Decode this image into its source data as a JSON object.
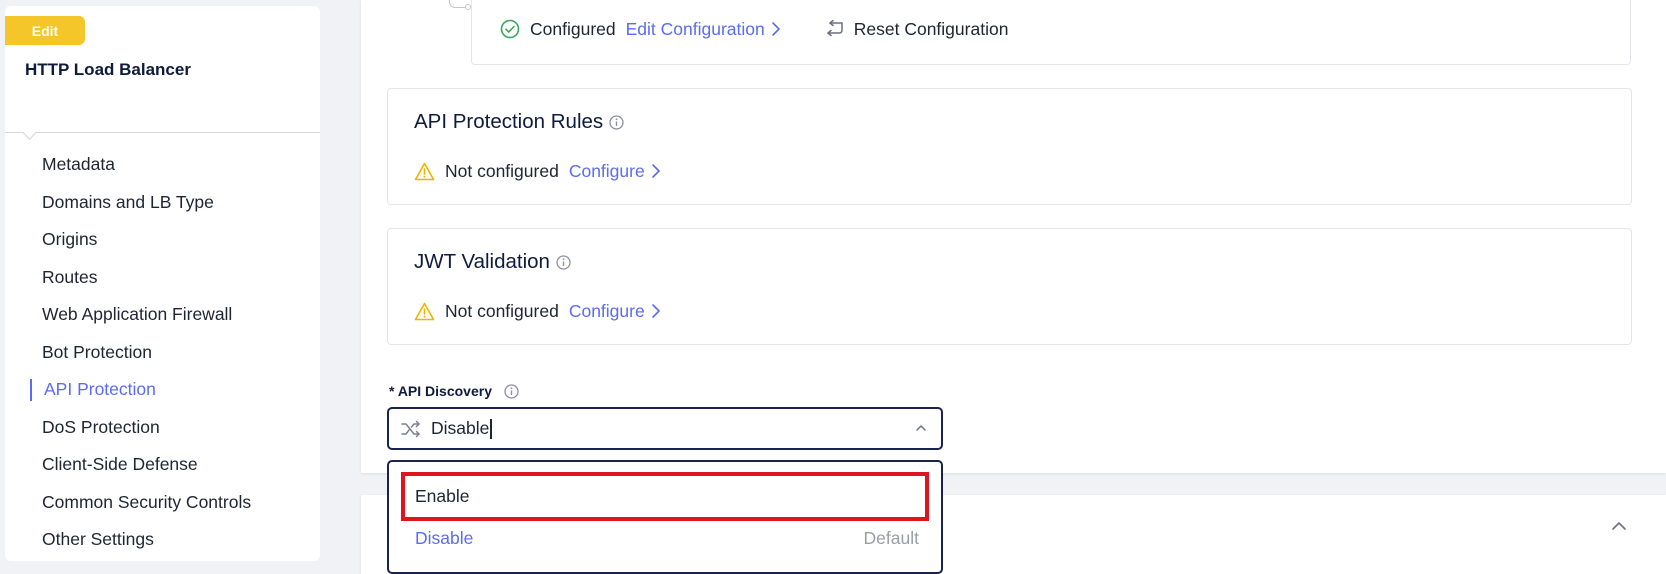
{
  "sidebar": {
    "badge": "Edit",
    "title": "HTTP Load Balancer",
    "items": [
      {
        "label": "Metadata"
      },
      {
        "label": "Domains and LB Type"
      },
      {
        "label": "Origins"
      },
      {
        "label": "Routes"
      },
      {
        "label": "Web Application Firewall"
      },
      {
        "label": "Bot Protection"
      },
      {
        "label": "API Protection"
      },
      {
        "label": "DoS Protection"
      },
      {
        "label": "Client-Side Defense"
      },
      {
        "label": "Common Security Controls"
      },
      {
        "label": "Other Settings"
      }
    ],
    "active_item": "API Protection"
  },
  "top_config": {
    "status": "Configured",
    "edit_link": "Edit Configuration",
    "reset_link": "Reset Configuration"
  },
  "sections": [
    {
      "title": "API Protection Rules",
      "status": "Not configured",
      "action": "Configure"
    },
    {
      "title": "JWT Validation",
      "status": "Not configured",
      "action": "Configure"
    }
  ],
  "api_discovery": {
    "label": "* API Discovery",
    "value": "Disable",
    "options": [
      {
        "label": "Enable",
        "note": ""
      },
      {
        "label": "Disable",
        "note": "Default"
      }
    ]
  },
  "colors": {
    "accent": "#5b6cf0",
    "badge": "#f5c62a",
    "success": "#3aa55d",
    "warning": "#f0b400",
    "highlight": "#e0141f"
  },
  "icons": [
    "check-circle-icon",
    "chevron-right-icon",
    "reset-arrow-icon",
    "info-icon",
    "warning-icon",
    "shuffle-icon",
    "chevron-up-icon"
  ]
}
